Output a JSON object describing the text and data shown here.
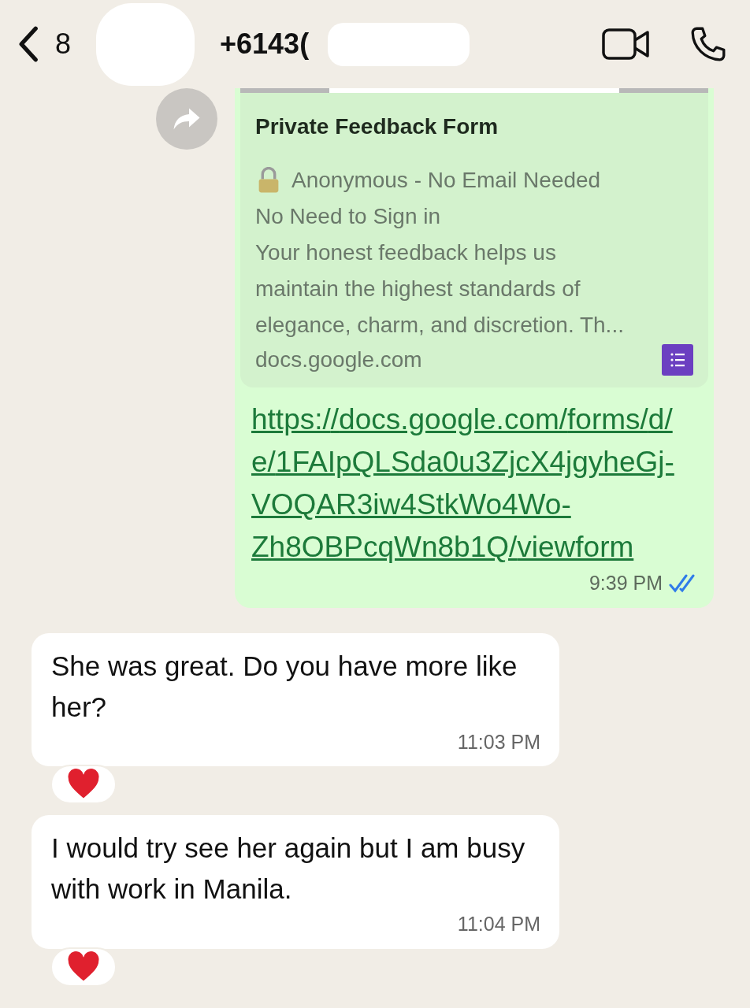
{
  "header": {
    "back_count": "8",
    "contact": "+6143("
  },
  "outgoing": {
    "preview": {
      "title": "Private Feedback Form",
      "lines": [
        "Anonymous - No Email Needed",
        "No Need to Sign in",
        "Your honest feedback helps us maintain the highest standards of elegance, charm, and discretion. Th..."
      ],
      "domain": "docs.google.com"
    },
    "link": "https://docs.google.com/forms/d/e/1FAIpQLSda0u3ZjcX4jgyheGj-VOQAR3iw4StkWo4Wo-Zh8OBPcqWn8b1Q/viewform",
    "time": "9:39 PM",
    "read": true
  },
  "incoming": [
    {
      "text": "She was great. Do you have more like her?",
      "time": "11:03 PM",
      "reacted": true
    },
    {
      "text": "I would try see her again but I am busy with work in Manila.",
      "time": "11:04 PM",
      "reacted": true
    }
  ]
}
